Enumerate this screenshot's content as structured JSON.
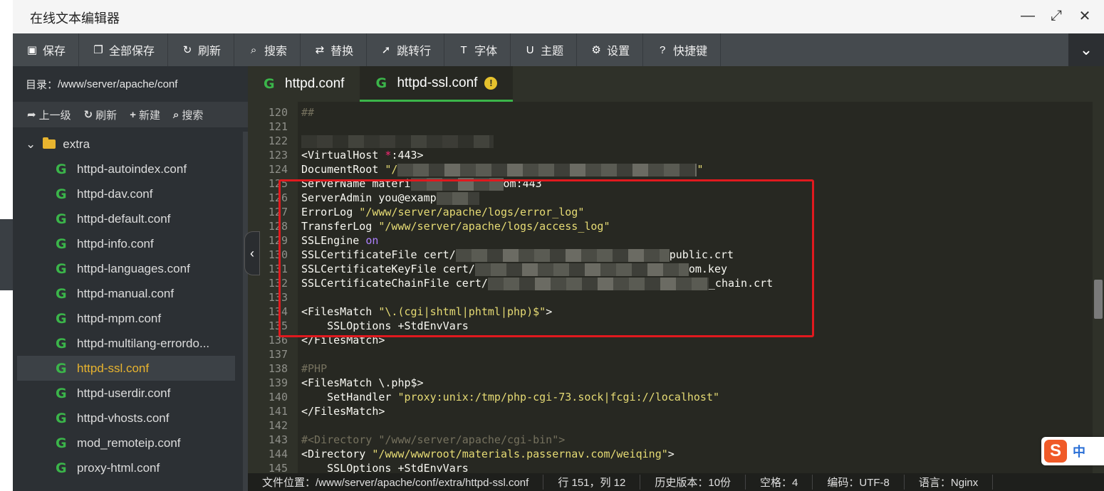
{
  "window": {
    "title": "在线文本编辑器",
    "controls": {
      "minimize": "—",
      "maximize": "⤢",
      "close": "✕"
    }
  },
  "toolbar": {
    "items": [
      {
        "label": "保存",
        "icon": "save-icon"
      },
      {
        "label": "全部保存",
        "icon": "save-all-icon"
      },
      {
        "label": "刷新",
        "icon": "refresh-icon"
      },
      {
        "label": "搜索",
        "icon": "search-icon"
      },
      {
        "label": "替换",
        "icon": "replace-icon"
      },
      {
        "label": "跳转行",
        "icon": "goto-line-icon"
      },
      {
        "label": "字体",
        "icon": "font-icon"
      },
      {
        "label": "主题",
        "icon": "theme-icon"
      },
      {
        "label": "设置",
        "icon": "gear-icon"
      },
      {
        "label": "快捷键",
        "icon": "help-icon"
      }
    ]
  },
  "sidebar": {
    "path_label": "目录：",
    "path": "/www/server/apache/conf",
    "actions": {
      "up": "上一级",
      "refresh": "刷新",
      "new": "新建",
      "search": "搜索"
    },
    "folder": "extra",
    "files": [
      "httpd-autoindex.conf",
      "httpd-dav.conf",
      "httpd-default.conf",
      "httpd-info.conf",
      "httpd-languages.conf",
      "httpd-manual.conf",
      "httpd-mpm.conf",
      "httpd-multilang-errordo...",
      "httpd-ssl.conf",
      "httpd-userdir.conf",
      "httpd-vhosts.conf",
      "mod_remoteip.conf",
      "proxy-html.conf"
    ],
    "active_file": "httpd-ssl.conf"
  },
  "tabs": [
    {
      "label": "httpd.conf"
    },
    {
      "label": "httpd-ssl.conf"
    }
  ],
  "code": {
    "lines": [
      {
        "n": "120",
        "text": "##"
      },
      {
        "n": "121",
        "text": ""
      },
      {
        "n": "122",
        "text": ""
      },
      {
        "n": "123",
        "a": "<VirtualHost ",
        "b": "*",
        "c": ":443>"
      },
      {
        "n": "124",
        "a": "DocumentRoot ",
        "s": "\"/",
        "s2": "\""
      },
      {
        "n": "125",
        "a": "ServerName materi",
        "c": "om:443"
      },
      {
        "n": "126",
        "a": "ServerAdmin you@examp"
      },
      {
        "n": "127",
        "a": "ErrorLog ",
        "s": "\"/www/server/apache/logs/error_log\""
      },
      {
        "n": "128",
        "a": "TransferLog ",
        "s": "\"/www/server/apache/logs/access_log\""
      },
      {
        "n": "129",
        "a": "SSLEngine ",
        "k": "on"
      },
      {
        "n": "130",
        "a": "SSLCertificateFile cert/",
        "c": "public.crt"
      },
      {
        "n": "131",
        "a": "SSLCertificateKeyFile cert/",
        "c": "om.key"
      },
      {
        "n": "132",
        "a": "SSLCertificateChainFile cert/",
        "c": "_chain.crt"
      },
      {
        "n": "133",
        "text": ""
      },
      {
        "n": "134",
        "a": "<FilesMatch ",
        "s": "\"\\.(cgi|shtml|phtml|php)$\"",
        "c": ">"
      },
      {
        "n": "135",
        "a": "    SSLOptions +StdEnvVars"
      },
      {
        "n": "136",
        "a": "</FilesMatch>"
      },
      {
        "n": "137",
        "text": ""
      },
      {
        "n": "138",
        "cm": "#PHP"
      },
      {
        "n": "139",
        "a": "<FilesMatch \\.php$>"
      },
      {
        "n": "140",
        "a": "    SetHandler ",
        "s": "\"proxy:unix:/tmp/php-cgi-73.sock|fcgi://localhost\""
      },
      {
        "n": "141",
        "a": "</FilesMatch>"
      },
      {
        "n": "142",
        "text": ""
      },
      {
        "n": "143",
        "cm": "#<Directory \"/www/server/apache/cgi-bin\">"
      },
      {
        "n": "144",
        "a": "<Directory ",
        "s": "\"/www/wwwroot/materials.passernav.com/weiqing\"",
        "c": ">"
      },
      {
        "n": "145",
        "a": "    SSLOptions +StdEnvVars"
      }
    ]
  },
  "status": {
    "file": "文件位置：/www/server/apache/conf/extra/httpd-ssl.conf",
    "pos": "行 151，列 12",
    "history": "历史版本：10份",
    "indent": "空格：4",
    "encoding": "编码：UTF-8",
    "lang": "语言：Nginx"
  },
  "ime": {
    "logo": "S",
    "mode": "中"
  }
}
